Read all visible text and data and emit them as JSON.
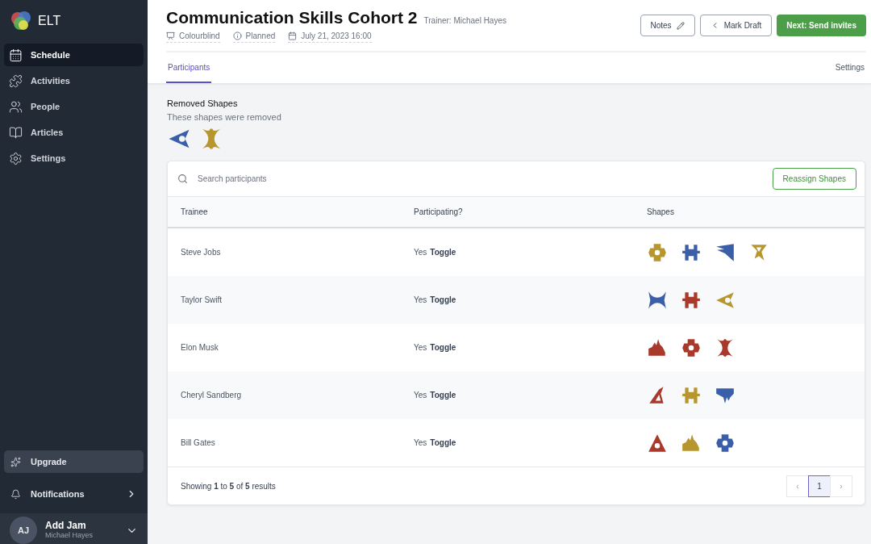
{
  "brand": {
    "name": "ELT"
  },
  "sidebar": {
    "items": [
      {
        "label": "Schedule",
        "kind": "calendar",
        "selected": true
      },
      {
        "label": "Activities",
        "kind": "puzzle",
        "selected": false
      },
      {
        "label": "People",
        "kind": "people",
        "selected": false
      },
      {
        "label": "Articles",
        "kind": "book",
        "selected": false
      },
      {
        "label": "Settings",
        "kind": "gear",
        "selected": false
      }
    ],
    "upgrade": "Upgrade",
    "notifications": "Notifications",
    "user": {
      "initials": "AJ",
      "name": "Add Jam",
      "subtitle": "Michael Hayes"
    }
  },
  "header": {
    "title": "Communication Skills Cohort 2",
    "trainer": "Trainer: Michael Hayes",
    "meta": [
      {
        "kind": "theme",
        "label": "Colourblind"
      },
      {
        "kind": "status",
        "label": "Planned"
      },
      {
        "kind": "date",
        "label": "July 21, 2023 16:00"
      }
    ],
    "buttons": {
      "notes": "Notes",
      "draft": "Mark Draft",
      "next": "Next: Send invites"
    }
  },
  "tabs": [
    {
      "label": "Participants",
      "selected": true
    },
    {
      "label": "Settings",
      "selected": false
    }
  ],
  "removed": {
    "title": "Removed Shapes",
    "subtitle": "These shapes were removed",
    "shapes": [
      {
        "kind": "eye",
        "color": "#3a5fa8"
      },
      {
        "kind": "hourglass",
        "color": "#b8962e"
      }
    ]
  },
  "search": {
    "placeholder": "Search participants"
  },
  "reassign": "Reassign Shapes",
  "table": {
    "columns": [
      "Trainee",
      "Participating?",
      "Shapes"
    ],
    "rows": [
      {
        "name": "Steve Jobs",
        "participating": "Yes",
        "toggle": "Toggle",
        "shapes": [
          {
            "kind": "ring",
            "color": "#b8962e"
          },
          {
            "kind": "comb",
            "color": "#3a5fa8"
          },
          {
            "kind": "flag",
            "color": "#3a5fa8"
          },
          {
            "kind": "funnel",
            "color": "#b8962e"
          }
        ]
      },
      {
        "name": "Taylor Swift",
        "participating": "Yes",
        "toggle": "Toggle",
        "shapes": [
          {
            "kind": "bowtie",
            "color": "#3a5fa8"
          },
          {
            "kind": "comb",
            "color": "#a8392b"
          },
          {
            "kind": "eye",
            "color": "#b8962e"
          }
        ]
      },
      {
        "name": "Elon Musk",
        "participating": "Yes",
        "toggle": "Toggle",
        "shapes": [
          {
            "kind": "crown",
            "color": "#a8392b"
          },
          {
            "kind": "ring",
            "color": "#a8392b"
          },
          {
            "kind": "hourglass",
            "color": "#a8392b"
          }
        ]
      },
      {
        "name": "Cheryl Sandberg",
        "participating": "Yes",
        "toggle": "Toggle",
        "shapes": [
          {
            "kind": "sail",
            "color": "#a8392b"
          },
          {
            "kind": "comb",
            "color": "#b8962e"
          },
          {
            "kind": "drip",
            "color": "#3a5fa8"
          }
        ]
      },
      {
        "name": "Bill Gates",
        "participating": "Yes",
        "toggle": "Toggle",
        "shapes": [
          {
            "kind": "peak",
            "color": "#a8392b"
          },
          {
            "kind": "crown",
            "color": "#b8962e"
          },
          {
            "kind": "ring",
            "color": "#3a5fa8"
          }
        ]
      }
    ]
  },
  "pagination": {
    "summary": "Showing **1** to **5** of **5** results",
    "prev": "‹",
    "pages": [
      {
        "label": "1",
        "selected": true
      }
    ],
    "next": "›"
  }
}
